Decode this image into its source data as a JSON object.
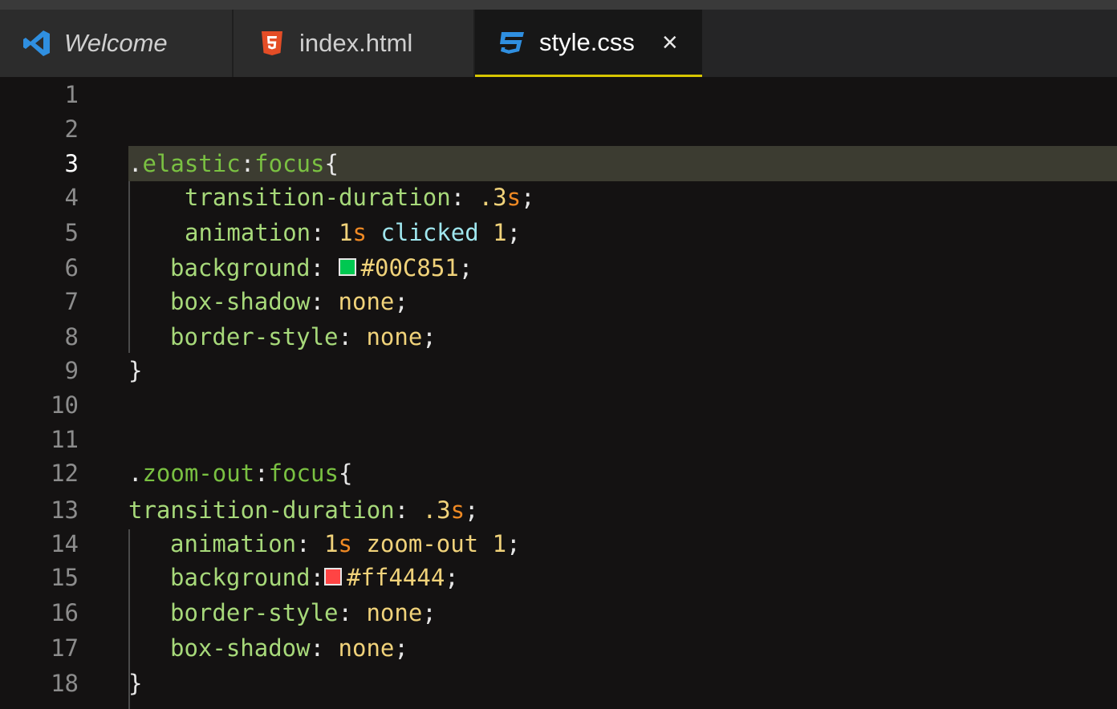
{
  "tabs": [
    {
      "label": "Welcome",
      "icon": "vscode-icon"
    },
    {
      "label": "index.html",
      "icon": "html5-icon"
    },
    {
      "label": "style.css",
      "icon": "css3-icon",
      "active": true,
      "close": "×"
    }
  ],
  "colors": {
    "swatch_green": "#00C851",
    "swatch_red": "#ff4444",
    "active_tab_border": "#d7c600"
  },
  "lines": [
    {
      "n": "1"
    },
    {
      "n": "2"
    },
    {
      "n": "3",
      "dot": ".",
      "sel": "elastic",
      "colon": ":",
      "pseudo": "focus",
      "brace": "{"
    },
    {
      "n": "4",
      "prop": "transition-duration",
      "colon": ": ",
      "num": ".3",
      "unit": "s",
      "semi": ";"
    },
    {
      "n": "5",
      "prop": "animation",
      "colon": ": ",
      "num": "1",
      "unit": "s",
      "ident": "clicked",
      "num2": "1",
      "semi": ";"
    },
    {
      "n": "6",
      "prop": "background",
      "colon": ": ",
      "hex": "#00C851",
      "semi": ";"
    },
    {
      "n": "7",
      "prop": "box-shadow",
      "colon": ": ",
      "kw": "none",
      "semi": ";"
    },
    {
      "n": "8",
      "prop": "border-style",
      "colon": ": ",
      "kw": "none",
      "semi": ";"
    },
    {
      "n": "9",
      "brace": "}"
    },
    {
      "n": "10"
    },
    {
      "n": "11"
    },
    {
      "n": "12",
      "dot": ".",
      "sel": "zoom-out",
      "colon": ":",
      "pseudo": "focus",
      "brace": "{"
    },
    {
      "n": "13",
      "prop": "transition-duration",
      "colon": ": ",
      "num": ".3",
      "unit": "s",
      "semi": ";"
    },
    {
      "n": "14",
      "prop": "animation",
      "colon": ": ",
      "num": "1",
      "unit": "s",
      "kw": "zoom-out",
      "num2": "1",
      "semi": ";"
    },
    {
      "n": "15",
      "prop": "background",
      "colon": ":",
      "hex": "#ff4444",
      "semi": ";"
    },
    {
      "n": "16",
      "prop": "border-style",
      "colon": ": ",
      "kw": "none",
      "semi": ";"
    },
    {
      "n": "17",
      "prop": "box-shadow",
      "colon": ": ",
      "kw": "none",
      "semi": ";"
    },
    {
      "n": "18",
      "brace": "}"
    }
  ]
}
